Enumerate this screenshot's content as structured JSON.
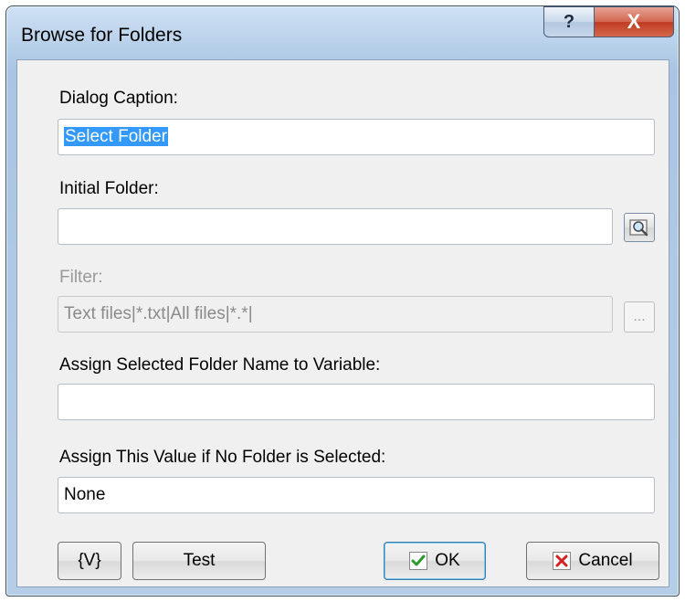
{
  "window": {
    "title": "Browse for Folders"
  },
  "titlebar": {
    "help_label": "?",
    "close_label": "X"
  },
  "fields": {
    "dialog_caption": {
      "label": "Dialog Caption:",
      "value": "Select Folder"
    },
    "initial_folder": {
      "label": "Initial Folder:",
      "value": ""
    },
    "filter": {
      "label": "Filter:",
      "value": "Text files|*.txt|All files|*.*|",
      "disabled": true
    },
    "assign_variable": {
      "label": "Assign Selected Folder Name to Variable:",
      "value": ""
    },
    "no_folder_value": {
      "label": "Assign This Value if No Folder is Selected:",
      "value": "None"
    }
  },
  "buttons": {
    "variables": "{V}",
    "test": "Test",
    "ok": "OK",
    "cancel": "Cancel",
    "filter_browse": "..."
  },
  "icons": {
    "browse": "magnifier-folder-icon",
    "ok": "check-icon",
    "cancel": "x-icon"
  },
  "colors": {
    "selection": "#3399ff",
    "ok_check": "#2a9a2a",
    "cancel_x": "#d42020"
  }
}
